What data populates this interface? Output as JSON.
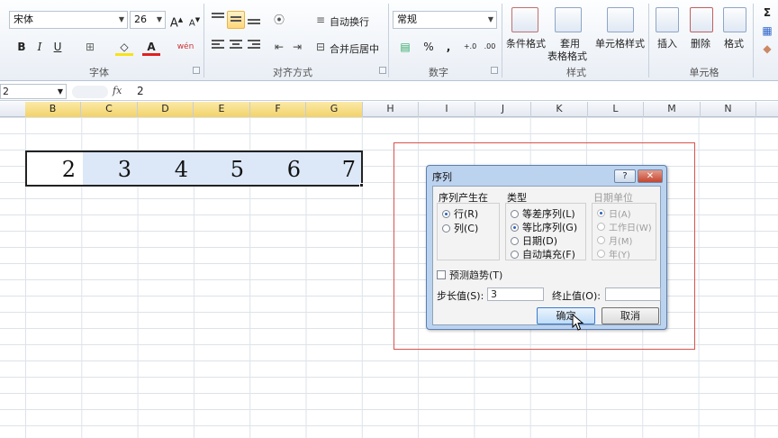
{
  "ribbon": {
    "font": {
      "name": "宋体",
      "size": "26",
      "grow_label": "A",
      "shrink_label": "A",
      "bold_label": "B",
      "italic_label": "I",
      "underline_label": "U",
      "border_label": "⊞",
      "fill_label": "◇",
      "color_label": "A",
      "phonetic_label": "wén",
      "group_label": "字体"
    },
    "alignment": {
      "wrap_label": "自动换行",
      "merge_label": "合并后居中",
      "group_label": "对齐方式"
    },
    "number": {
      "format": "常规",
      "percent_label": "%",
      "comma_label": ",",
      "inc_decimal_label": "+.0",
      "dec_decimal_label": ".00",
      "group_label": "数字"
    },
    "styles": {
      "conditional_label": "条件格式",
      "table_label_1": "套用",
      "table_label_2": "表格格式",
      "cell_styles_label": "单元格样式",
      "group_label": "样式"
    },
    "cells": {
      "insert_label": "插入",
      "delete_label": "删除",
      "format_label": "格式",
      "group_label": "单元格"
    },
    "editing": {
      "sum_label": "Σ"
    }
  },
  "formula_bar": {
    "name_box": "2",
    "fx_label": "fx",
    "value": "2"
  },
  "columns": [
    "B",
    "C",
    "D",
    "E",
    "F",
    "G",
    "H",
    "I",
    "J",
    "K",
    "L",
    "M",
    "N"
  ],
  "cells": [
    "2",
    "3",
    "4",
    "5",
    "6",
    "7"
  ],
  "dialog": {
    "title": "序列",
    "help_label": "?",
    "close_label": "✕",
    "series_in": {
      "title": "序列产生在",
      "row": "行(R)",
      "column": "列(C)"
    },
    "type": {
      "title": "类型",
      "linear": "等差序列(L)",
      "growth": "等比序列(G)",
      "date": "日期(D)",
      "autofill": "自动填充(F)"
    },
    "date_unit": {
      "title": "日期单位",
      "day": "日(A)",
      "weekday": "工作日(W)",
      "month": "月(M)",
      "year": "年(Y)"
    },
    "trend_label": "预测趋势(T)",
    "step_label": "步长值(S):",
    "step_value": "3",
    "stop_label": "终止值(O):",
    "stop_value": "",
    "ok_label": "确定",
    "cancel_label": "取消"
  },
  "colors": {
    "selection_fill": "#dce8f7",
    "annotation_border": "#d9534f",
    "header_selected": "#f2d26a"
  }
}
